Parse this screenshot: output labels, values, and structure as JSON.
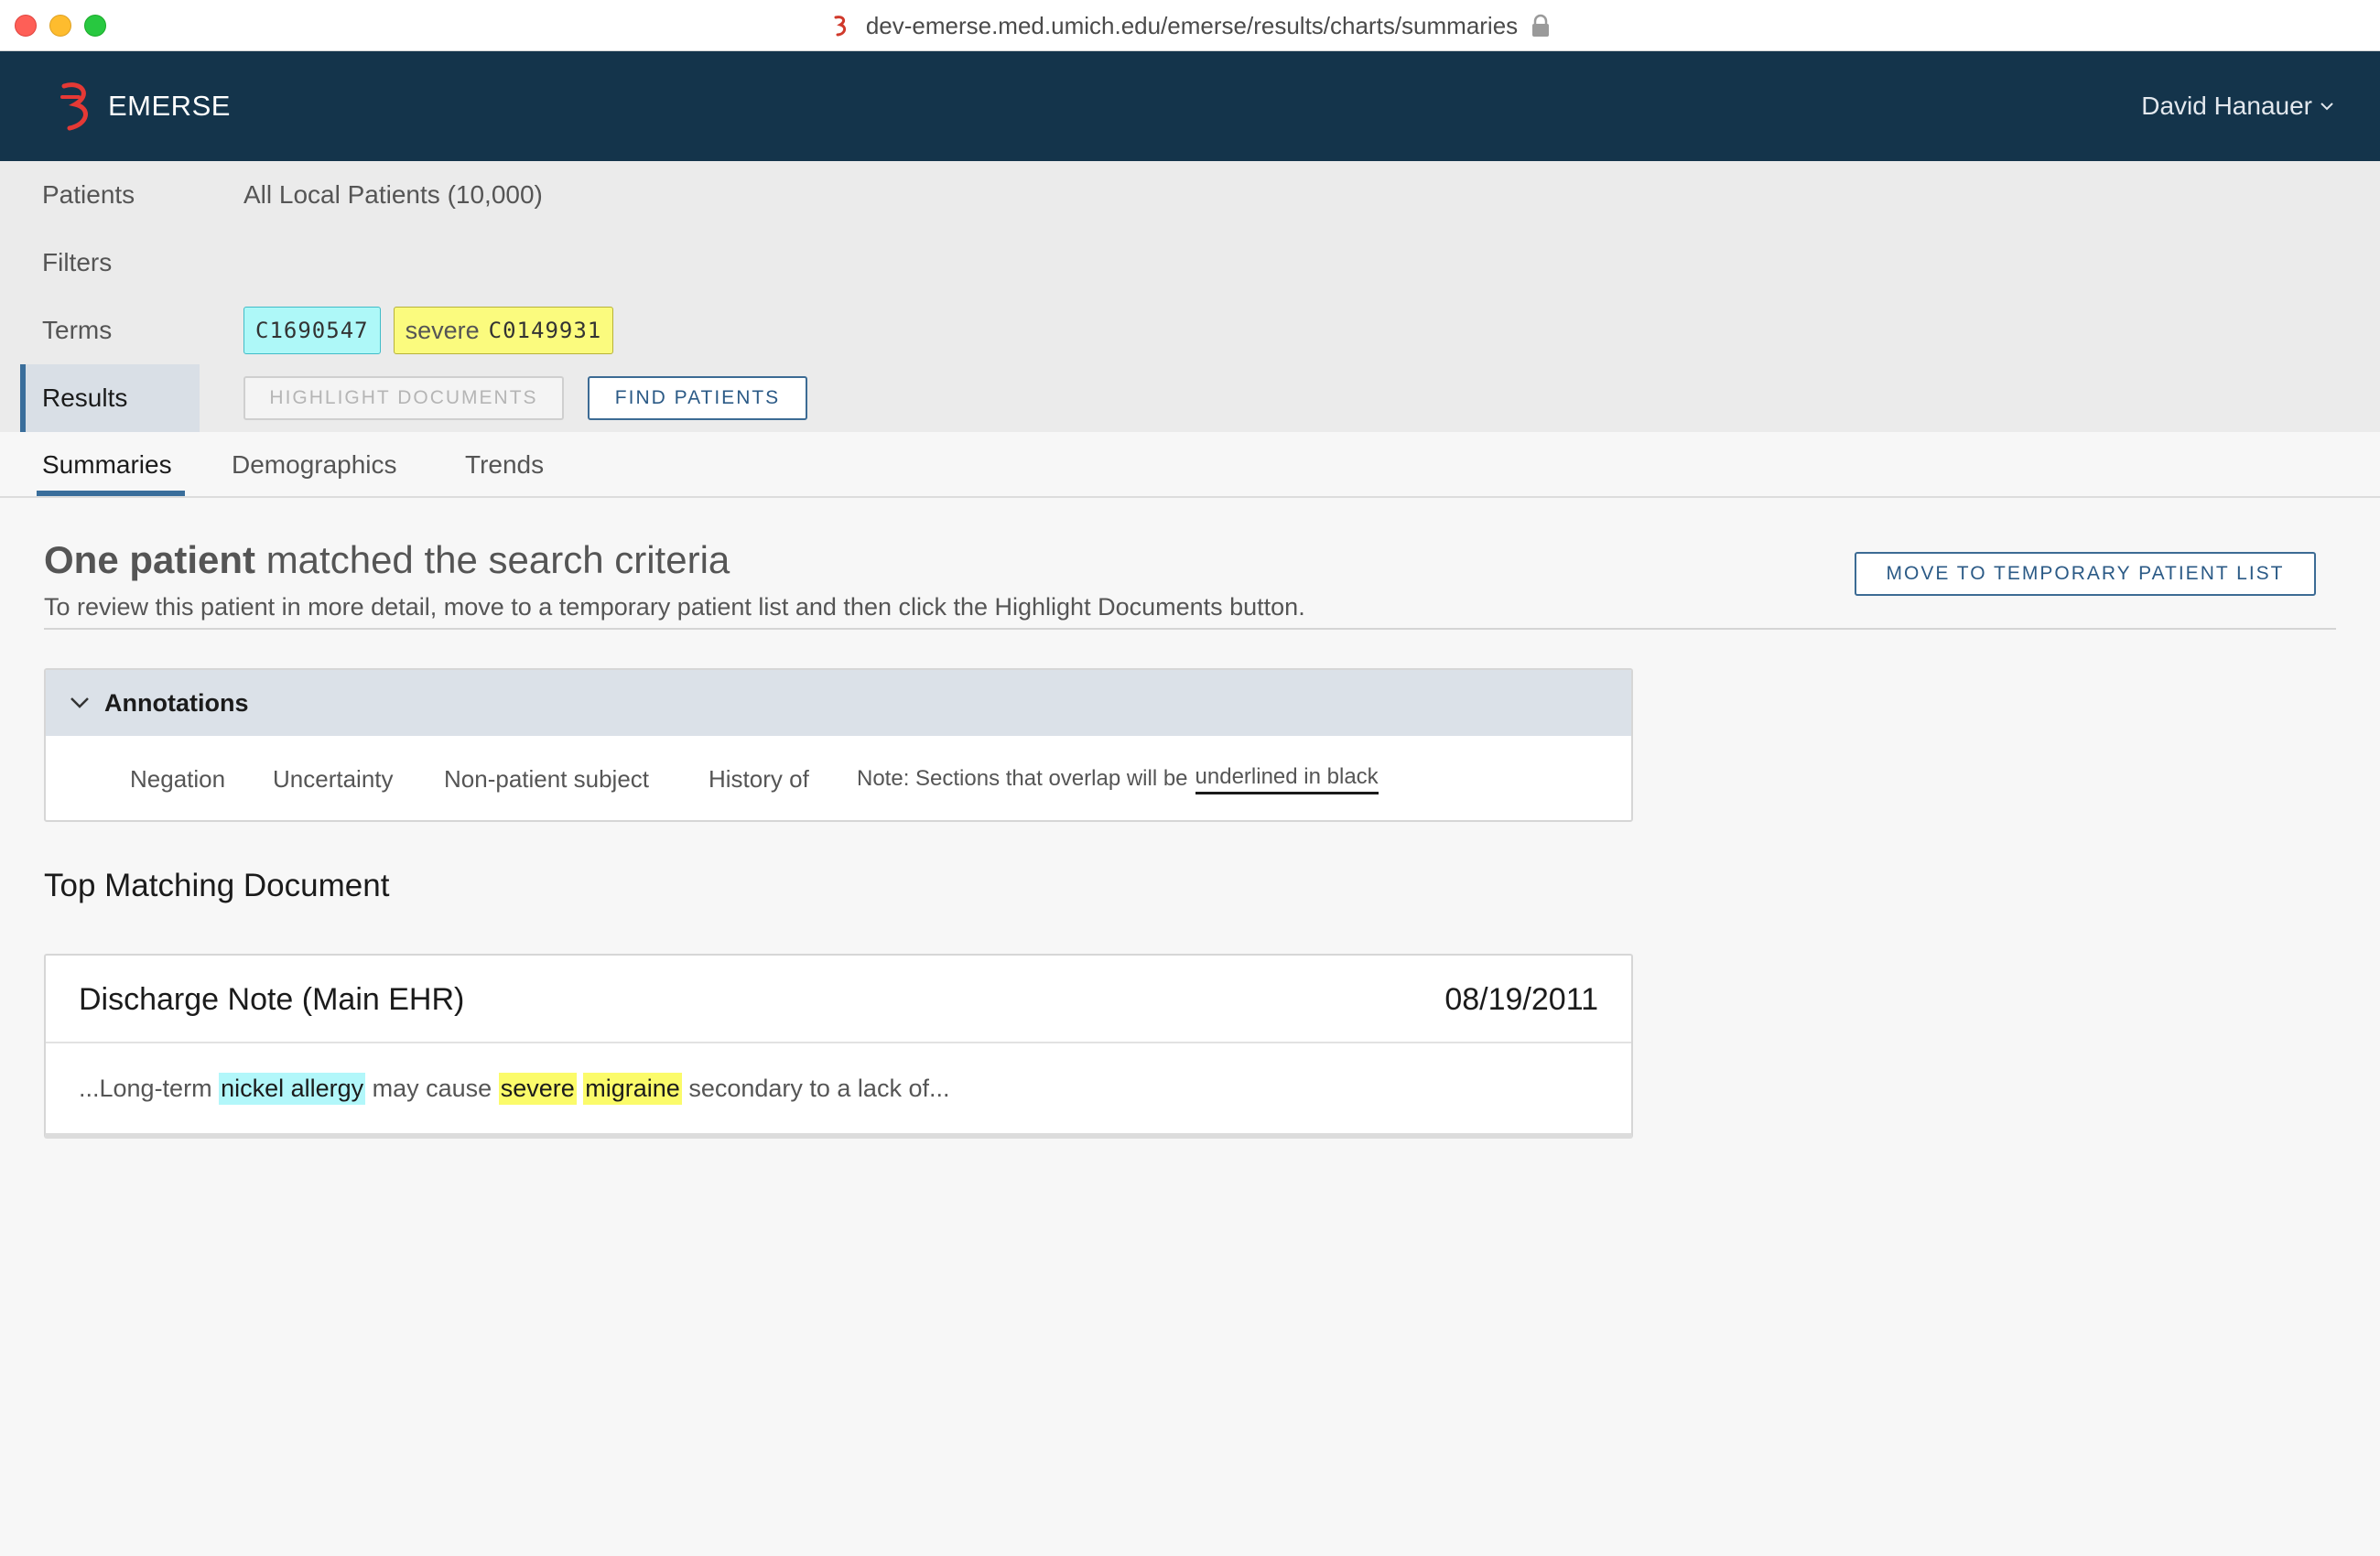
{
  "browser": {
    "url": "dev-emerse.med.umich.edu/emerse/results/charts/summaries"
  },
  "app": {
    "name": "EMERSE",
    "user": "David Hanauer",
    "brand_color": "#14344b",
    "accent_color": "#3a6e9b"
  },
  "query": {
    "rows": [
      {
        "label": "Patients",
        "value": "All Local Patients (10,000)"
      },
      {
        "label": "Filters",
        "value": ""
      },
      {
        "label": "Terms"
      },
      {
        "label": "Results"
      }
    ],
    "terms": [
      {
        "text": "",
        "code": "C1690547",
        "color": "#aef8f8"
      },
      {
        "text": "severe",
        "code": "C0149931",
        "color": "#fbfb7e"
      }
    ],
    "buttons": {
      "highlight": "HIGHLIGHT DOCUMENTS",
      "find": "FIND PATIENTS"
    }
  },
  "tabs": [
    {
      "label": "Summaries",
      "active": true
    },
    {
      "label": "Demographics",
      "active": false
    },
    {
      "label": "Trends",
      "active": false
    }
  ],
  "summary": {
    "headline_bold": "One patient",
    "headline_rest": " matched the search criteria",
    "subline": "To review this patient in more detail, move to a temporary patient list and then click the Highlight Documents button.",
    "move_button": "MOVE TO TEMPORARY PATIENT LIST"
  },
  "annotations": {
    "title": "Annotations",
    "items": [
      "Negation",
      "Uncertainty",
      "Non-patient subject",
      "History of"
    ],
    "note_prefix": "Note: Sections that overlap will be",
    "note_underlined": "underlined in black"
  },
  "top_document": {
    "section_title": "Top Matching Document",
    "title": "Discharge Note (Main EHR)",
    "date": "08/19/2011",
    "snippet": {
      "pre": "...Long-term ",
      "hl1": "nickel allergy",
      "mid": " may cause ",
      "hl2": "severe",
      "space": " ",
      "hl3": "migraine",
      "post": " secondary to a lack of..."
    }
  }
}
